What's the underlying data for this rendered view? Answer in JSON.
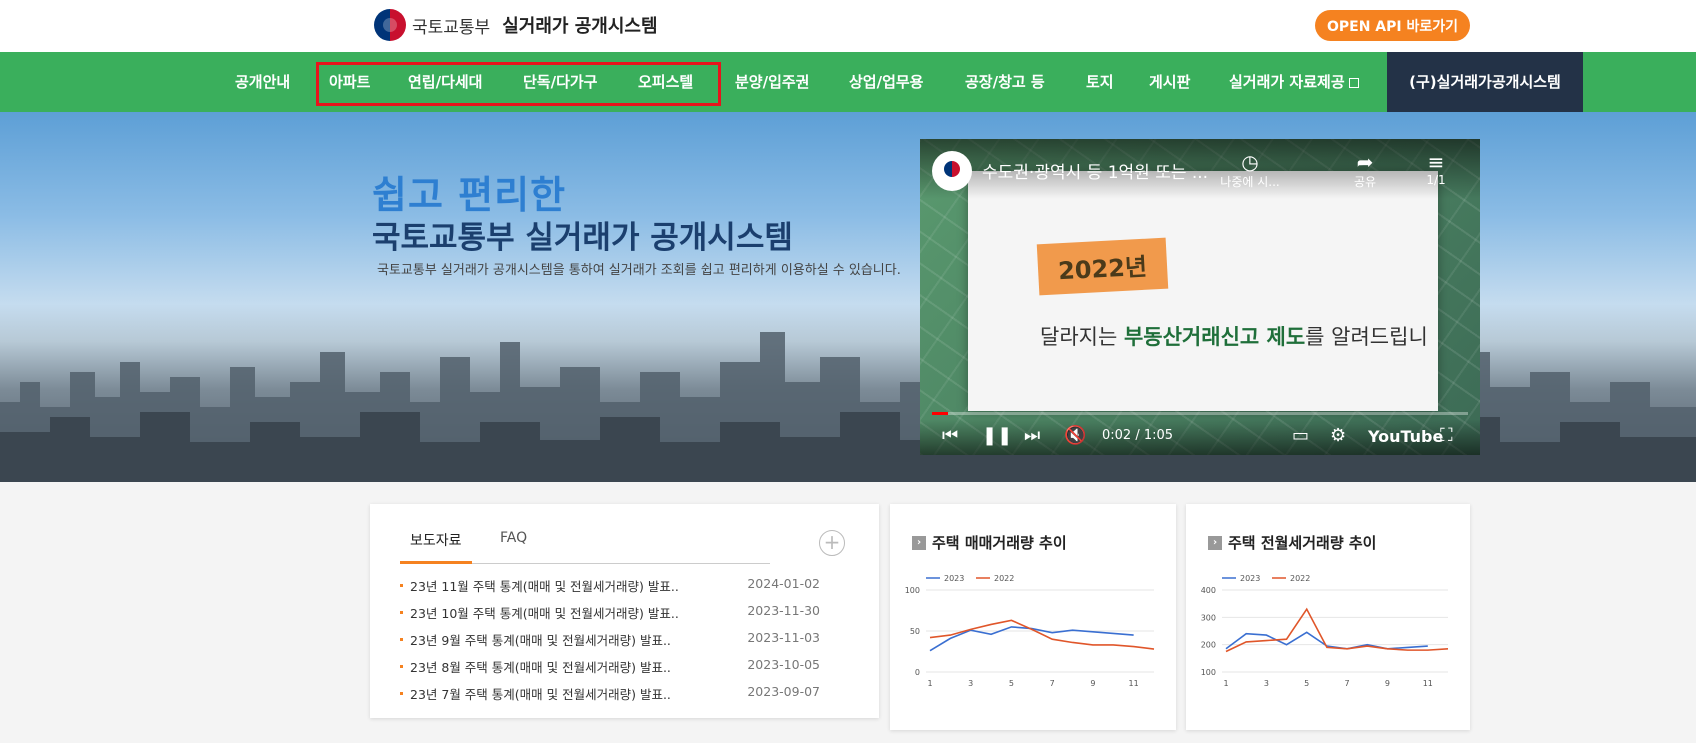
{
  "header": {
    "org": "국토교통부",
    "system": "실거래가 공개시스템",
    "api_button": "OPEN API 바로가기"
  },
  "nav": {
    "items": [
      "공개안내",
      "아파트",
      "연립/다세대",
      "단독/다가구",
      "오피스텔",
      "분양/입주권",
      "상업/업무용",
      "공장/창고 등",
      "토지",
      "게시판",
      "실거래가 자료제공"
    ],
    "old_system": "(구)실거래가공개시스템"
  },
  "hero": {
    "headline": "쉽고 편리한",
    "subheadline": "국토교통부 실거래가 공개시스템",
    "description": "국토교통부 실거래가 공개시스템을 통하여 실거래가 조회를 쉽고 편리하게 이용하실 수 있습니다."
  },
  "video": {
    "title": "수도권·광역시 등 1억원 또는 ...",
    "watch_later": "나중에 시...",
    "share": "공유",
    "playlist": "1/1",
    "year_tag": "2022년",
    "card_text_pre": "달라지는 ",
    "card_text_bold": "부동산거래신고 제도",
    "card_text_post": "를 알려드립니",
    "time": "0:02 / 1:05",
    "brand": "YouTube",
    "progress": 0.03
  },
  "press": {
    "tabs": [
      "보도자료",
      "FAQ"
    ],
    "items": [
      {
        "title": "23년 11월 주택 통계(매매 및 전월세거래량) 발표..",
        "date": "2024-01-02"
      },
      {
        "title": "23년 10월 주택 통계(매매 및 전월세거래량) 발표..",
        "date": "2023-11-30"
      },
      {
        "title": "23년 9월 주택 통계(매매 및 전월세거래량) 발표..",
        "date": "2023-11-03"
      },
      {
        "title": "23년 8월 주택 통계(매매 및 전월세거래량) 발표..",
        "date": "2023-10-05"
      },
      {
        "title": "23년 7월 주택 통계(매매 및 전월세거래량) 발표..",
        "date": "2023-09-07"
      }
    ]
  },
  "colors": {
    "accent": "#3aaf5c",
    "orange": "#f58220",
    "series_2023": "#3a6fd1",
    "series_2022": "#e0562a"
  },
  "chart_data": [
    {
      "type": "line",
      "title": "주택 매매거래량 추이",
      "x": [
        1,
        2,
        3,
        4,
        5,
        6,
        7,
        8,
        9,
        10,
        11,
        12
      ],
      "xticks": [
        1,
        3,
        5,
        7,
        9,
        11
      ],
      "yticks": [
        0,
        50,
        100
      ],
      "ylim": [
        0,
        100
      ],
      "series": [
        {
          "name": "2023",
          "values": [
            26,
            41,
            51,
            46,
            55,
            53,
            48,
            51,
            49,
            47,
            45,
            null
          ]
        },
        {
          "name": "2022",
          "values": [
            42,
            45,
            52,
            58,
            63,
            52,
            40,
            36,
            33,
            33,
            31,
            28
          ]
        }
      ]
    },
    {
      "type": "line",
      "title": "주택 전월세거래량 추이",
      "x": [
        1,
        2,
        3,
        4,
        5,
        6,
        7,
        8,
        9,
        10,
        11,
        12
      ],
      "xticks": [
        1,
        3,
        5,
        7,
        9,
        11
      ],
      "yticks": [
        100,
        200,
        300,
        400
      ],
      "ylim": [
        100,
        400
      ],
      "series": [
        {
          "name": "2023",
          "values": [
            185,
            240,
            235,
            200,
            245,
            195,
            185,
            200,
            185,
            190,
            195,
            null
          ]
        },
        {
          "name": "2022",
          "values": [
            175,
            210,
            215,
            220,
            330,
            190,
            185,
            195,
            185,
            180,
            180,
            185
          ]
        }
      ]
    }
  ]
}
